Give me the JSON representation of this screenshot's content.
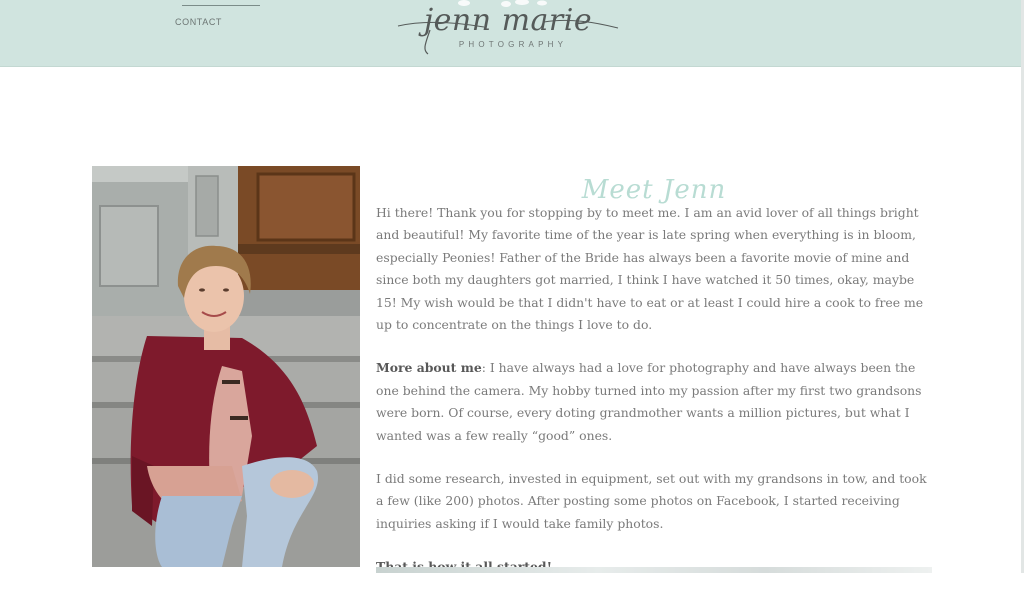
{
  "nav": {
    "contact_label": "CONTACT"
  },
  "logo": {
    "script": "jenn marie",
    "subtitle": "PHOTOGRAPHY"
  },
  "about": {
    "title": "Meet Jenn",
    "intro": "Hi there! Thank you for stopping by to meet me. I am an avid lover of all things bright and beautiful! My favorite time of the year is late spring when everything is in bloom, especially Peonies! Father of the Bride has always been a favorite movie of mine and since both my daughters got married, I think I have watched it 50 times, okay, maybe 15! My wish would be that I didn't have to eat or at least I could hire a cook to free me up to concentrate on the things I love to do.",
    "more_label": "More about me",
    "more_text": ": I have always had a love for photography and have always been the one behind the camera. My hobby turned into my passion after my first two grandsons were born. Of course, every doting grandmother wants a million pictures, but what I wanted was a few really “good” ones.",
    "research": "I did some research, invested in equipment, set out with my grandsons in tow, and took a few (like 200) photos. After posting some photos on Facebook, I started receiving inquiries asking if I would take family photos.",
    "closing": "That is how it all started!"
  },
  "colors": {
    "header_bg": "#d0e4df",
    "title_mint": "#b8dcd3",
    "body_text": "#7a7a7a"
  }
}
